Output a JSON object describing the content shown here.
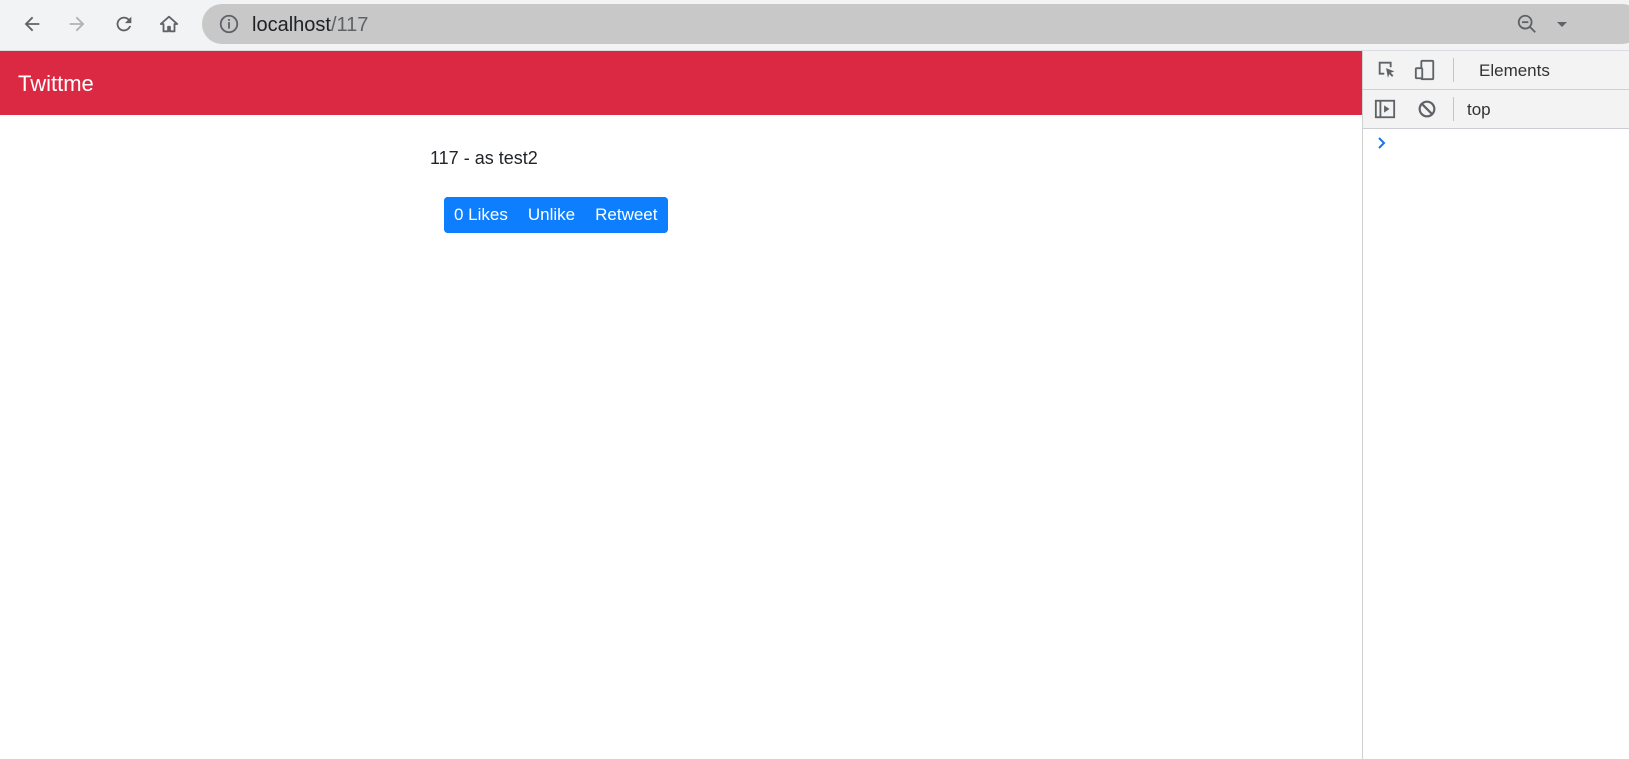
{
  "browser": {
    "url_host": "localhost",
    "url_path": "/117",
    "icons": [
      "back-icon",
      "forward-icon",
      "reload-icon",
      "home-icon",
      "info-icon",
      "zoom-out-icon",
      "chevron-down-icon"
    ]
  },
  "app": {
    "brand": "Twittme",
    "accent_color": "#dc2943"
  },
  "tweet": {
    "text": "117 - as test2",
    "buttons": {
      "likes": "0 Likes",
      "unlike": "Unlike",
      "retweet": "Retweet"
    },
    "button_color": "#0d7efd"
  },
  "devtools": {
    "tab": "Elements",
    "context": "top",
    "icons": [
      "inspect-icon",
      "device-toggle-icon",
      "sidebar-toggle-icon",
      "clear-console-icon",
      "console-prompt-icon"
    ]
  }
}
